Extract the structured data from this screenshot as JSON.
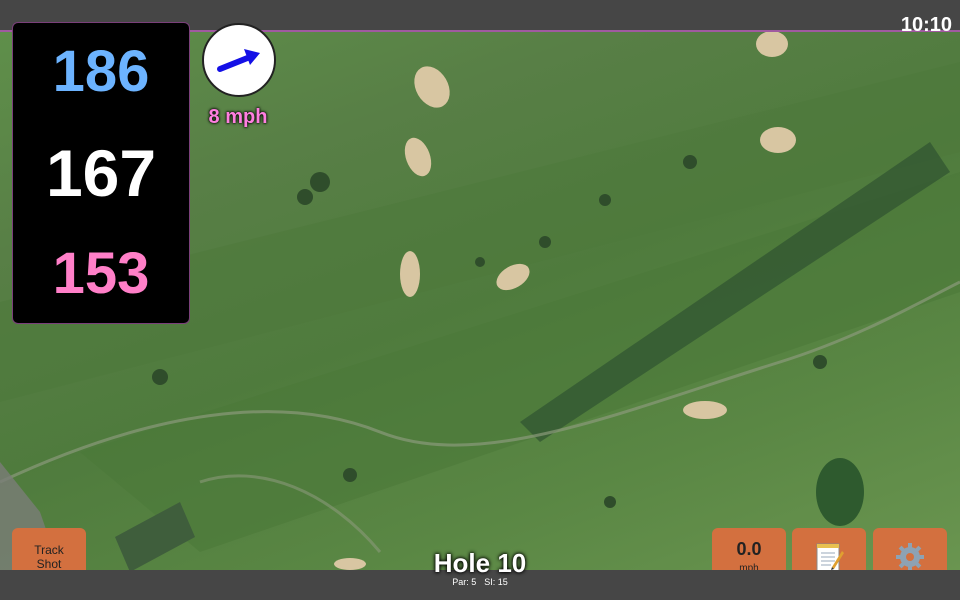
{
  "status": {
    "time": "10:10"
  },
  "distances": {
    "back": "186",
    "center": "167",
    "front": "153"
  },
  "wind": {
    "speed_label": "8 mph",
    "icon": "wind-direction-arrow-icon"
  },
  "buttons": {
    "track_shot_line1": "Track",
    "track_shot_line2": "Shot",
    "wind_value": "0.0",
    "wind_unit": "mph",
    "notes_icon": "notepad-icon",
    "settings_icon": "gear-icon"
  },
  "hole": {
    "title": "Hole 10",
    "par": "Par: 5",
    "si": "SI: 15"
  },
  "colors": {
    "accent": "#d3703f",
    "back_distance": "#6cb3ff",
    "front_distance": "#ff7fc8",
    "bar": "#464646"
  }
}
